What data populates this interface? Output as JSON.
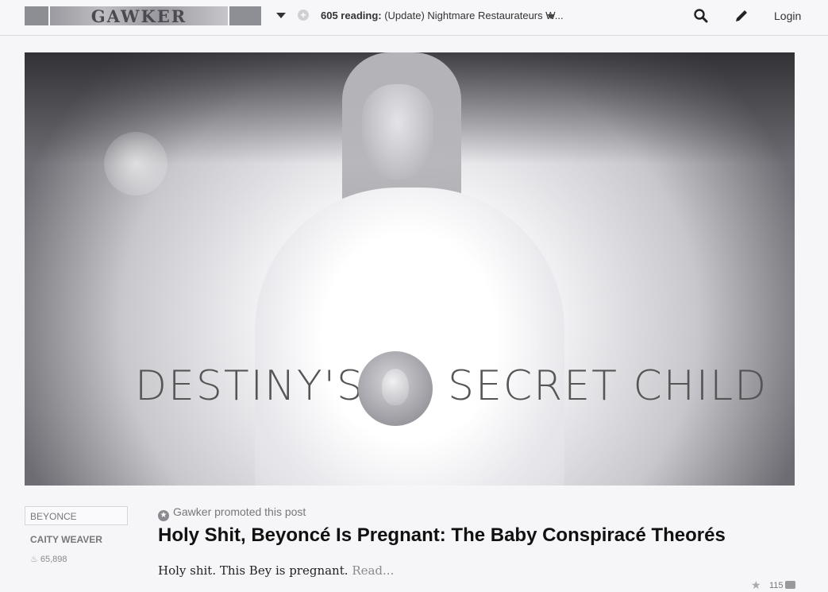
{
  "header": {
    "logo_text": "GAWKER",
    "reading_count": "605 reading:",
    "reading_title": "(Update) Nightmare Restaurateurs W...",
    "login_label": "Login"
  },
  "hero": {
    "title_left": "DESTINY'S",
    "title_right": "SECRET CHILD"
  },
  "article": {
    "tag": "BEYONCE",
    "author": "CAITY WEAVER",
    "views": "65,898",
    "promo": "Gawker promoted this post",
    "headline": "Holy Shit, Beyoncé Is Pregnant: The Baby Conspiracé Theorés",
    "excerpt": "Holy shit. This Bey is pregnant.",
    "read_more": "Read...",
    "likes": "115"
  },
  "icons": [
    "chevron-down-icon",
    "plus-icon",
    "search-icon",
    "pencil-icon",
    "flame-icon",
    "star-icon",
    "comment-icon"
  ]
}
